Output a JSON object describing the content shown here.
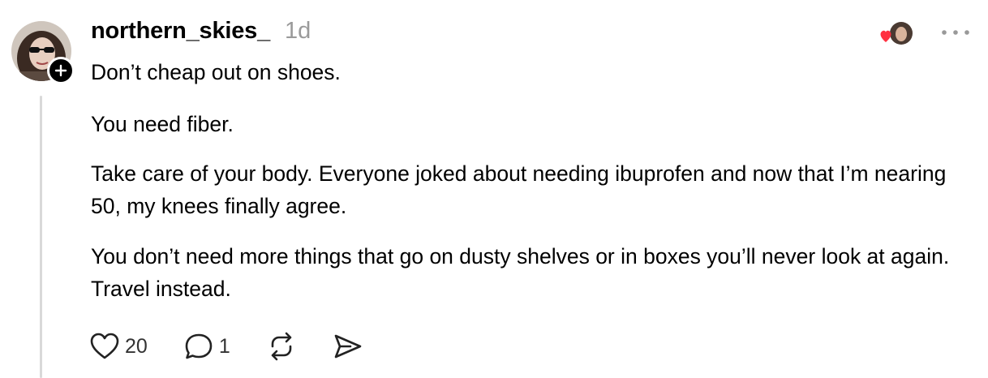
{
  "post": {
    "username": "northern_skies_",
    "timestamp": "1d",
    "paragraphs": [
      "Don’t cheap out on shoes.",
      "You need fiber.",
      "Take care of your body. Everyone joked about needing ibuprofen and now that I’m nearing 50, my knees finally agree.",
      "You don’t need more things that go on dusty shelves or in boxes you’ll never look at again. Travel instead."
    ]
  },
  "actions": {
    "like_count": "20",
    "reply_count": "1"
  },
  "icons": {
    "follow": "plus-icon",
    "like": "heart-icon",
    "reply": "speech-bubble-icon",
    "repost": "repost-icon",
    "share": "send-icon",
    "more": "more-horizontal-icon",
    "liked_by": "red-heart-icon"
  },
  "colors": {
    "text": "#000000",
    "muted": "#9a9a9a",
    "thread_line": "#d9d9d9",
    "heart_red": "#ff3040"
  }
}
